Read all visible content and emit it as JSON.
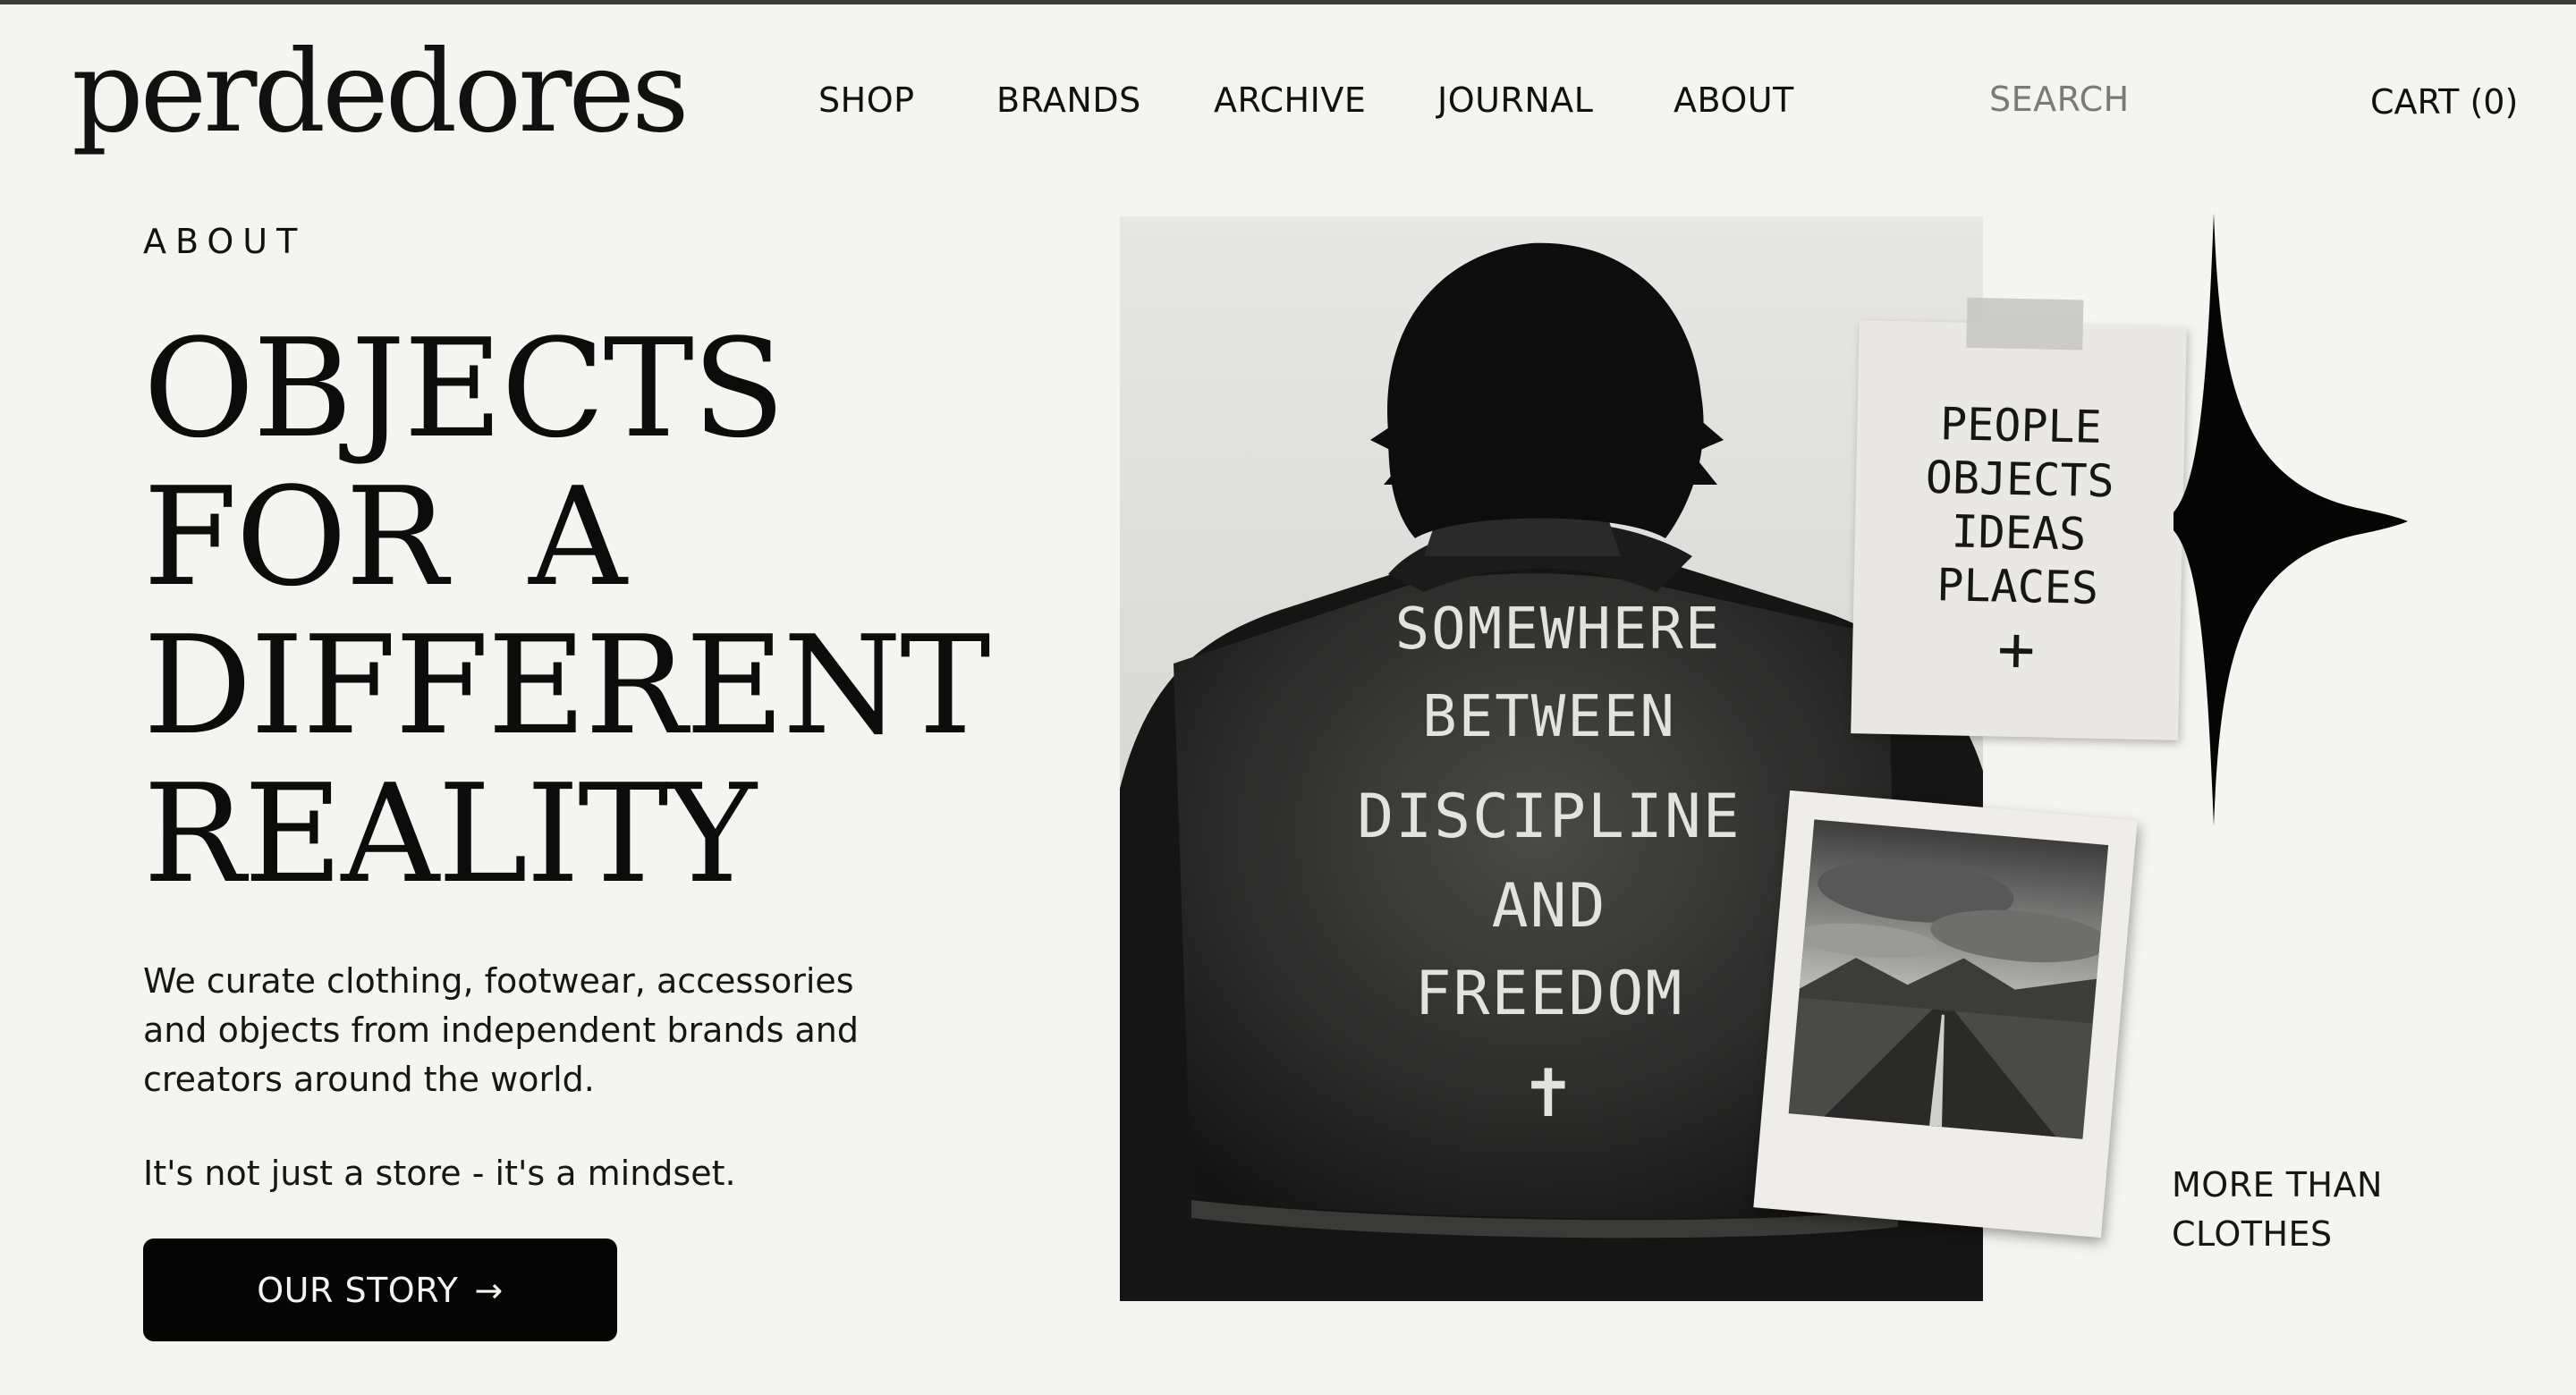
{
  "brand": {
    "logo": "perdedores"
  },
  "nav": {
    "items": [
      {
        "label": "SHOP"
      },
      {
        "label": "BRANDS"
      },
      {
        "label": "ARCHIVE"
      },
      {
        "label": "JOURNAL"
      },
      {
        "label": "ABOUT"
      }
    ],
    "search_placeholder": "SEARCH",
    "cart_label": "CART (0)"
  },
  "hero": {
    "eyebrow": "ABOUT",
    "headline": [
      "OBJECTS",
      "FOR  A",
      "DIFFERENT",
      "REALITY"
    ],
    "intro": "We curate clothing, footwear, accessories and objects from independent brands and creators around the world.",
    "tagline": "It's not just a store - it's a mindset.",
    "cta_label": "OUR STORY",
    "cta_arrow": "→"
  },
  "image": {
    "jacket_lines": [
      "SOMEWHERE",
      "BETWEEN",
      "DISCIPLINE",
      "AND",
      "FREEDOM",
      "✝"
    ],
    "note_lines": [
      "PEOPLE",
      "OBJECTS",
      "IDEAS",
      "PLACES",
      "+"
    ]
  },
  "side_caption": "MORE THAN CLOTHES",
  "colors": {
    "background": "#f4f4f0",
    "text": "#111111",
    "button": "#050505"
  }
}
